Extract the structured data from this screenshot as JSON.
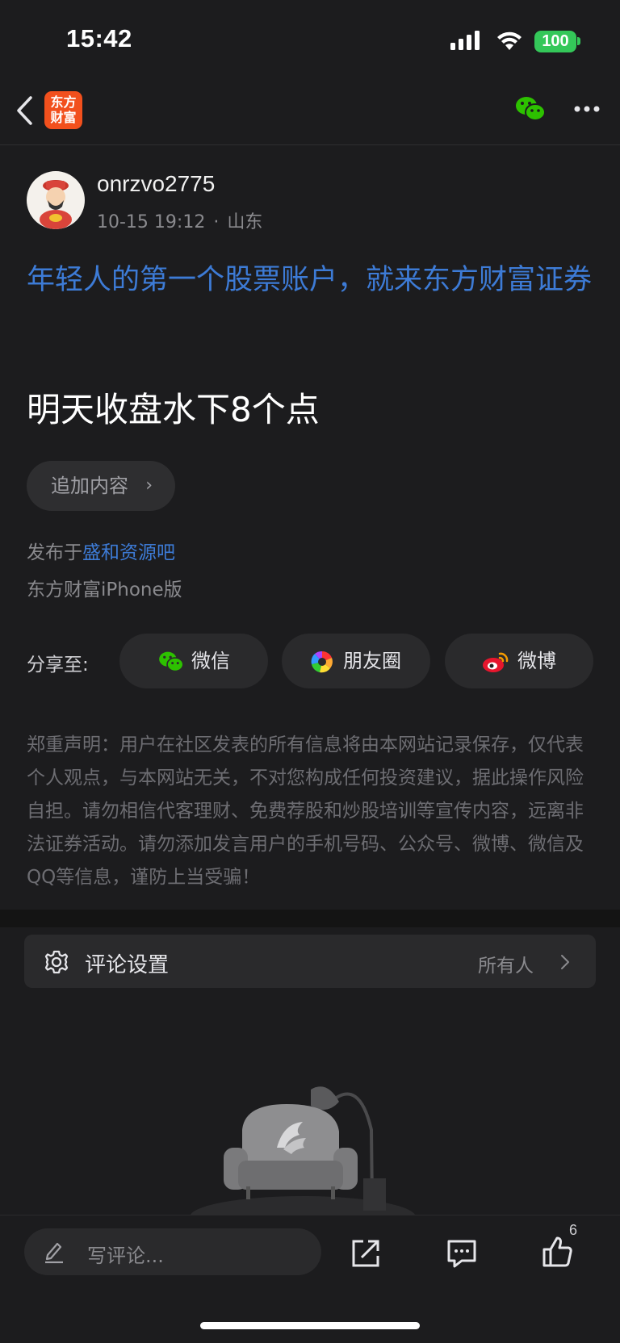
{
  "status_bar": {
    "time": "15:42",
    "battery": "100"
  },
  "nav": {
    "logo_line1": "东方",
    "logo_line2": "财富"
  },
  "post": {
    "username": "onrzvo2775",
    "datetime": "10-15 19:12",
    "location": "山东",
    "ad_text": "年轻人的第一个股票账户，就来东方财富证券",
    "content": "明天收盘水下8个点",
    "add_content_label": "追加内容",
    "posted_prefix": "发布于",
    "posted_bar": "盛和资源吧",
    "device": "东方财富iPhone版"
  },
  "share": {
    "label": "分享至:",
    "wechat": "微信",
    "moments": "朋友圈",
    "weibo": "微博"
  },
  "disclaimer": "郑重声明：用户在社区发表的所有信息将由本网站记录保存，仅代表个人观点，与本网站无关，不对您构成任何投资建议，据此操作风险自担。请勿相信代客理财、免费荐股和炒股培训等宣传内容，远离非法证券活动。请勿添加发言用户的手机号码、公众号、微博、微信及QQ等信息，谨防上当受骗！",
  "comment_settings": {
    "label": "评论设置",
    "value": "所有人"
  },
  "bottom_bar": {
    "comment_placeholder": "写评论...",
    "like_count": "6"
  },
  "colors": {
    "link_blue": "#3d7bd6",
    "brand_orange": "#f2501d",
    "wechat_green": "#2dc100"
  }
}
